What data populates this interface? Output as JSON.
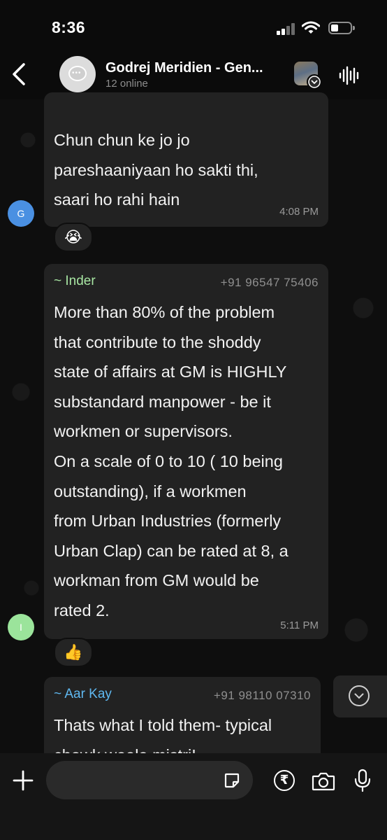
{
  "status_bar": {
    "time": "8:36"
  },
  "header": {
    "back_icon": "chevron-left-icon",
    "group_name": "Godrej Meridien - Gen...",
    "subtitle": "12 online",
    "community_badge_icon": "chevron-down-icon",
    "voice_chat_icon": "waveform-icon"
  },
  "messages": [
    {
      "avatar_letter": "G",
      "avatar_color": "#4a90e2",
      "text": "Chun chun ke jo jo\npareshaaniyaan ho sakti thi,\nsaari ho rahi hain",
      "time": "4:08 PM",
      "reaction": "😭"
    },
    {
      "avatar_letter": "I",
      "avatar_color": "#9be49b",
      "sender": "~ Inder",
      "sender_color": "#a8e6a3",
      "phone": "+91 96547 75406",
      "text": "More than 80% of the problem\nthat contribute to the shoddy\nstate of affairs at GM is HIGHLY\nsubstandard manpower - be it\nworkmen or supervisors.\nOn a scale of 0 to 10 ( 10 being\noutstanding), if  a workmen\nfrom Urban Industries (formerly\nUrban Clap) can be rated at 8, a\nworkman from GM would be\nrated 2.",
      "time": "5:11 PM",
      "reaction": "👍"
    },
    {
      "sender": "~ Aar Kay",
      "sender_color": "#5fb8f0",
      "phone": "+91 98110 07310",
      "text": "Thats what I told them- typical\nchowk waala mistri!"
    }
  ],
  "scroll_down_icon": "chevron-down-circle-icon",
  "composer": {
    "placeholder": "",
    "attach_icon": "plus-icon",
    "sticker_icon": "sticker-icon",
    "payment_icon": "rupee-icon",
    "payment_symbol": "₹",
    "camera_icon": "camera-icon",
    "mic_icon": "mic-icon"
  }
}
